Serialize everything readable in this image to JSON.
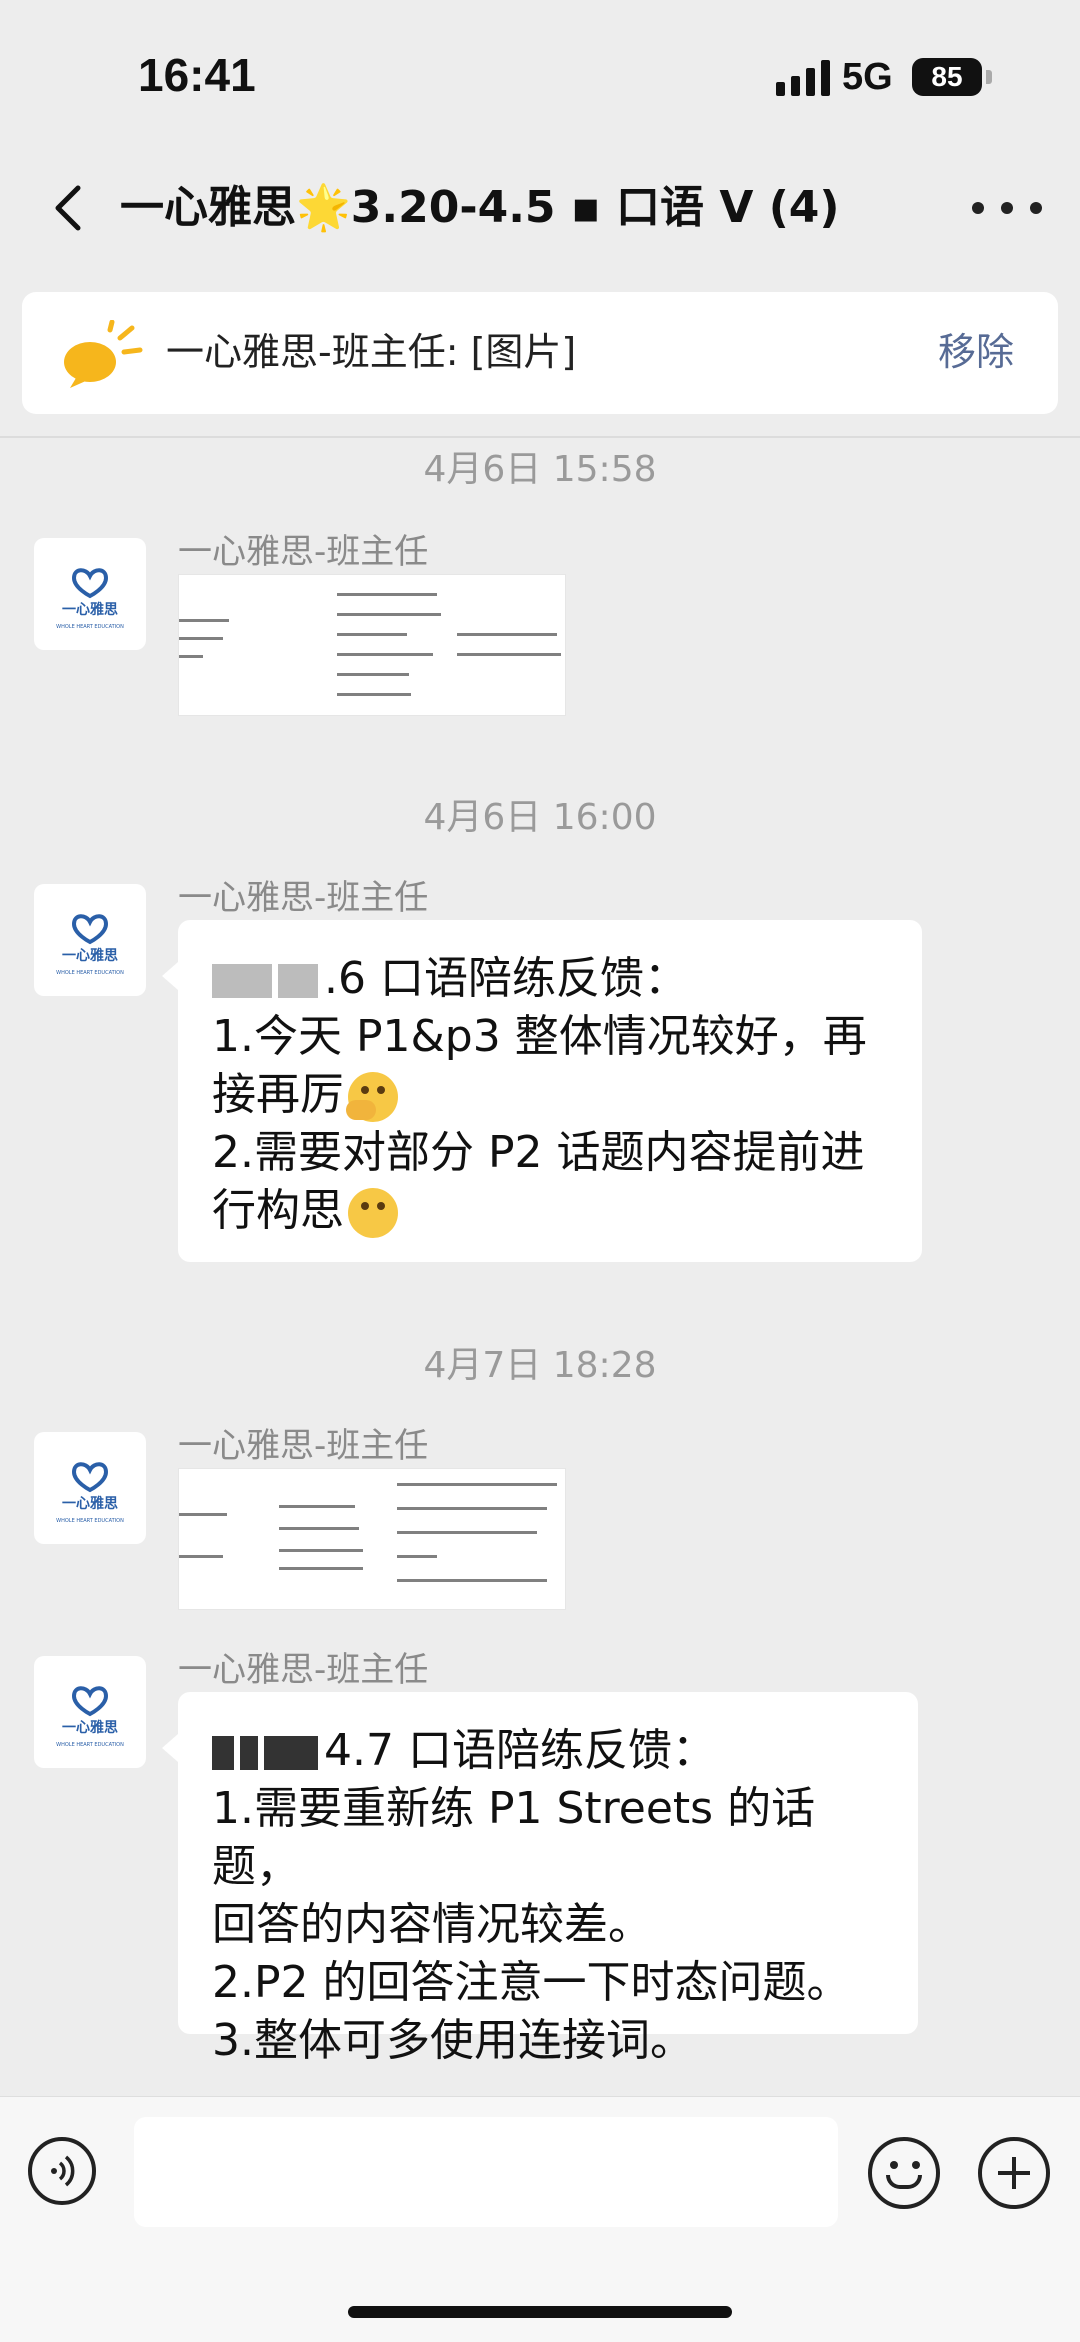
{
  "status_bar": {
    "time": "16:41",
    "network": "5G",
    "battery": "85"
  },
  "header": {
    "title": "一心雅思🌟3.20-4.5 ▪ 口语 V (4)"
  },
  "pinned": {
    "text": "一心雅思-班主任: [图片]",
    "remove_label": "移除"
  },
  "messages": [
    {
      "timestamp": "4月6日 15:58",
      "sender": "一心雅思-班主任",
      "type": "image"
    },
    {
      "timestamp": "4月6日 16:00",
      "sender": "一心雅思-班主任",
      "type": "text",
      "line1": ".6 口语陪练反馈：",
      "line2": "1.今天 P1&p3 整体情况较好，再",
      "line3": "接再厉",
      "line4": "2.需要对部分 P2 话题内容提前进",
      "line5": "行构思"
    },
    {
      "timestamp": "4月7日 18:28",
      "sender": "一心雅思-班主任",
      "type": "image"
    },
    {
      "sender": "一心雅思-班主任",
      "type": "text",
      "line1": "4.7 口语陪练反馈：",
      "line2": "1.需要重新练 P1 Streets 的话题，",
      "line3": "回答的内容情况较差。",
      "line4": "2.P2 的回答注意一下时态问题。",
      "line5": "3.整体可多使用连接词。"
    }
  ],
  "avatar": {
    "brand": "一心雅思",
    "tagline": "WHOLE HEART EDUCATION"
  },
  "input": {
    "placeholder": ""
  },
  "colors": {
    "accent_link": "#576b95",
    "background": "#ededed",
    "brand_blue": "#2a5fa8"
  }
}
